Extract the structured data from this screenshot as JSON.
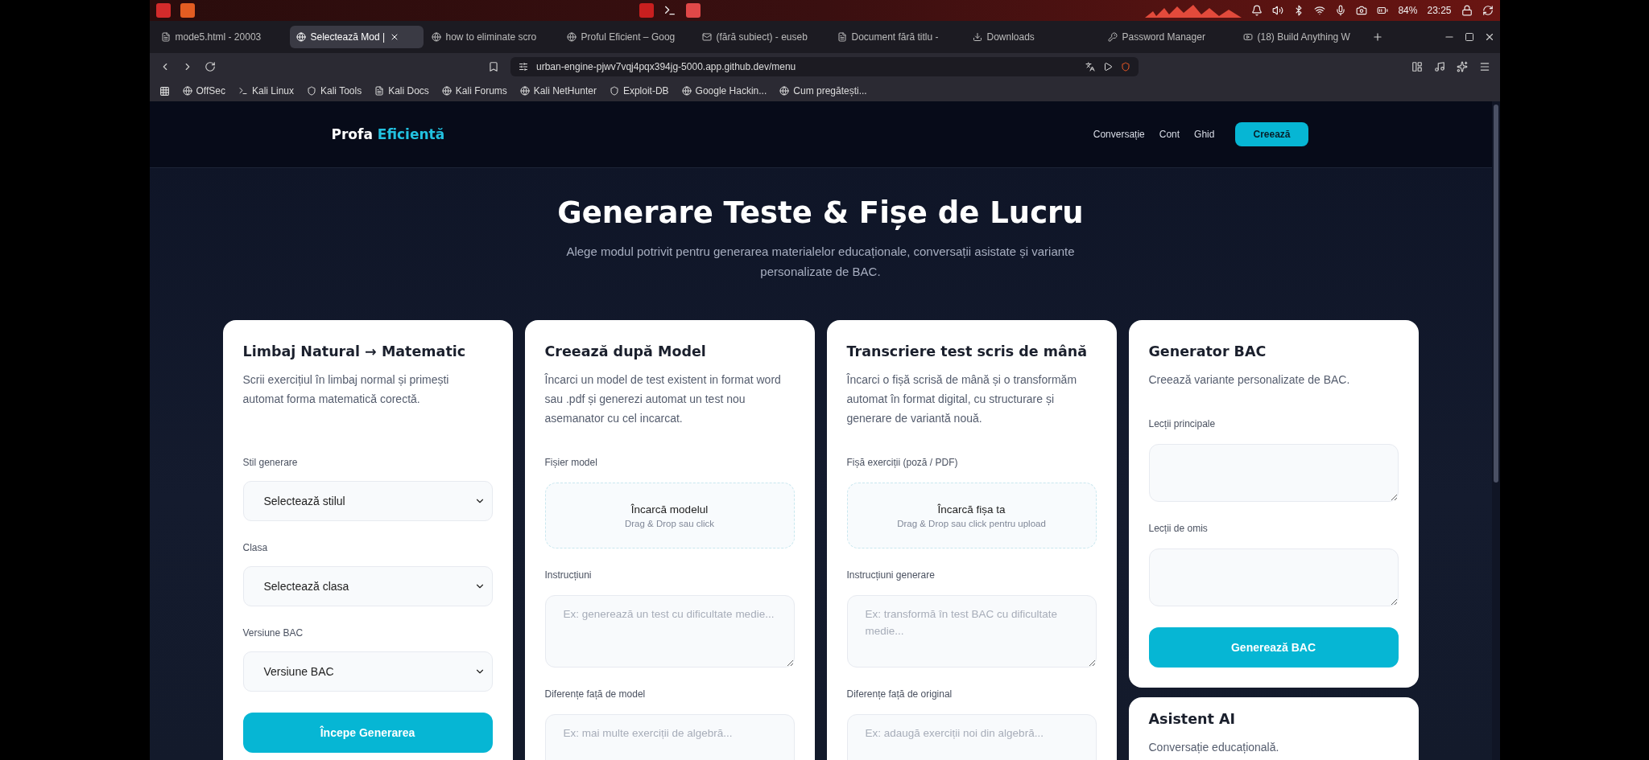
{
  "os_panel": {
    "battery": "84%",
    "clock": "23:25"
  },
  "browser_tabs": [
    {
      "label": "mode5.html - 20003",
      "selected": false
    },
    {
      "label": "Selectează Mod |",
      "selected": true
    },
    {
      "label": "how to eliminate scro",
      "selected": false
    },
    {
      "label": "Proful Eficient – Goog",
      "selected": false
    },
    {
      "label": "(fără subiect) - euseb",
      "selected": false
    },
    {
      "label": "Document fără titlu -",
      "selected": false
    },
    {
      "label": "Downloads",
      "selected": false
    },
    {
      "label": "Password Manager",
      "selected": false
    },
    {
      "label": "(18) Build Anything W",
      "selected": false
    }
  ],
  "address_bar": {
    "url": "urban-engine-pjwv7vqj4pqx394jg-5000.app.github.dev/menu"
  },
  "bookmarks": [
    "OffSec",
    "Kali Linux",
    "Kali Tools",
    "Kali Docs",
    "Kali Forums",
    "Kali NetHunter",
    "Exploit-DB",
    "Google Hackin...",
    "Cum pregătești..."
  ],
  "site_nav": {
    "brand": "Profa",
    "brand_accent": "Eficientă",
    "links": [
      "Conversație",
      "Cont",
      "Ghid"
    ],
    "cta": "Creează"
  },
  "hero": {
    "title": "Generare Teste & Fișe de Lucru",
    "subtitle": "Alege modul potrivit pentru generarea materialelor educaționale, conversații asistate și variante personalizate de BAC."
  },
  "columns": [
    [
      {
        "title": "Limbaj Natural → Matematic",
        "description": "Scrii exercițiul în limbaj normal și primești automat forma matematică corectă.",
        "fields": [
          {
            "kind": "select",
            "label": "Stil generare",
            "value": "Selectează stilul"
          },
          {
            "kind": "select",
            "label": "Clasa",
            "value": "Selectează clasa"
          },
          {
            "kind": "select",
            "label": "Versiune BAC",
            "value": "Versiune BAC"
          },
          {
            "kind": "button",
            "label": "Începe Generarea"
          }
        ]
      }
    ],
    [
      {
        "title": "Creează după Model",
        "description": "Încarci un model de test existent in format word sau .pdf și generezi automat un test nou asemanator cu cel incarcat.",
        "fields": [
          {
            "kind": "upload",
            "label": "Fișier model",
            "title": "Încarcă modelul",
            "hint": "Drag & Drop sau click"
          },
          {
            "kind": "textarea",
            "label": "Instrucțiuni",
            "placeholder": "Ex: generează un test cu dificultate medie..."
          },
          {
            "kind": "textarea",
            "label": "Diferențe față de model",
            "placeholder": "Ex: mai multe exerciții de algebră..."
          }
        ]
      }
    ],
    [
      {
        "title": "Transcriere test scris de mână",
        "description": "Încarci o fișă scrisă de mână și o transformăm automat în format digital, cu structurare și generare de variantă nouă.",
        "fields": [
          {
            "kind": "upload",
            "label": "Fișă exerciții (poză / PDF)",
            "title": "Încarcă fișa ta",
            "hint": "Drag & Drop sau click pentru upload"
          },
          {
            "kind": "textarea",
            "label": "Instrucțiuni generare",
            "placeholder": "Ex: transformă în test BAC cu dificultate medie..."
          },
          {
            "kind": "textarea",
            "label": "Diferențe față de original",
            "placeholder": "Ex: adaugă exerciții noi din algebră..."
          }
        ]
      }
    ],
    [
      {
        "title": "Generator BAC",
        "description": "Creează variante personalizate de BAC.",
        "fields": [
          {
            "kind": "textarea",
            "label": "Lecții principale"
          },
          {
            "kind": "textarea",
            "label": "Lecții de omis"
          },
          {
            "kind": "button",
            "label": "Generează BAC"
          }
        ]
      },
      {
        "title": "Asistent AI",
        "description": "Conversație educațională."
      }
    ]
  ]
}
